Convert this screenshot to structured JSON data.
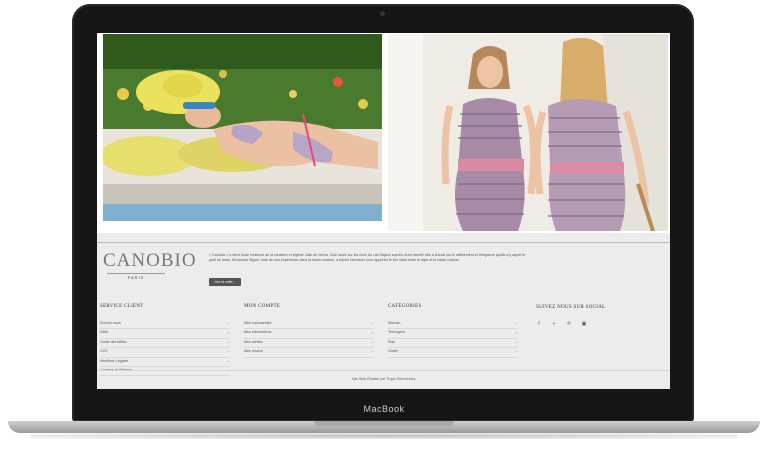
{
  "device": {
    "label": "MacBook"
  },
  "footer": {
    "logo": {
      "name": "CANOBIO",
      "subtitle": "PARIS"
    },
    "about_text": "« Canobio » a servi toute l'enfance de la créatrice et styliste Julie de Nerva. Club lancé sur les rives du Lac Majeur auprès d'une famille très à cheval sur le raffinement et l'élégance quelle a y apprit le goût du beau. Alexandra Sigoni, forte de son expérience dans la haute couture, a rejoint l'aventure pour apporter le lien idéal entre le style et la haute couture.",
    "about_button": "Lire la suite...",
    "columns": [
      {
        "title": "SERVICE CLIENT",
        "items": [
          "Écrivez-nous",
          "Délis",
          "Guide des tailles",
          "CGV",
          "Mentions Légales",
          "Livraison et Retours"
        ]
      },
      {
        "title": "MON COMPTE",
        "items": [
          "Mes commandes",
          "Mes informations",
          "Mes alertes",
          "Mes retours"
        ]
      },
      {
        "title": "CATÉGORIES",
        "items": [
          "Woman",
          "Teenagers",
          "Kids",
          "Outlet"
        ]
      }
    ],
    "social": {
      "title": "SUIVEZ NOUS SUR SOCIAL",
      "icons": [
        "facebook-icon",
        "rss-icon",
        "pinterest-icon",
        "instagram-icon"
      ]
    },
    "credit": "Site Web Réalisé par Tropic Elementary"
  }
}
